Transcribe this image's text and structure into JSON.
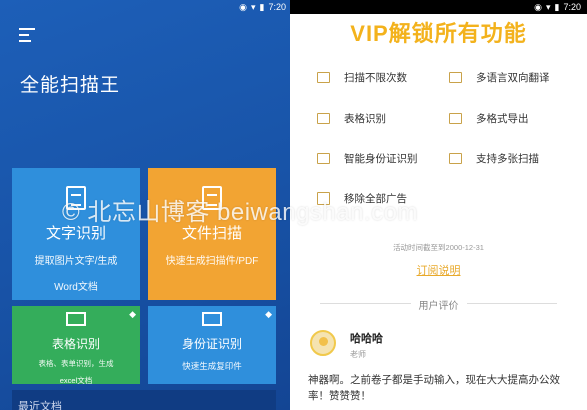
{
  "status": {
    "time": "7:20"
  },
  "left": {
    "app_title": "全能扫描王",
    "tiles": {
      "text_recognition": {
        "label": "文字识别",
        "desc_line1": "提取图片文字/生成",
        "desc_line2": "Word文档"
      },
      "file_scan": {
        "label": "文件扫描",
        "desc_line1": "快速生成扫描件/PDF"
      },
      "table_recognition": {
        "label": "表格识别",
        "desc_line1": "表格、表单识别，生成",
        "desc_line2": "excel文档"
      },
      "id_recognition": {
        "label": "身份证识别",
        "desc_line1": "快速生成复印件"
      }
    },
    "bottom_label": "最近文档"
  },
  "right": {
    "title": "VIP解锁所有功能",
    "features": [
      "扫描不限次数",
      "多语言双向翻译",
      "表格识别",
      "多格式导出",
      "智能身份证识别",
      "支持多张扫描",
      "移除全部广告"
    ],
    "promo_time": "活动时间截至到2000-12-31",
    "subscribe_label": "订阅说明",
    "reviews_heading": "用户评价",
    "review": {
      "name": "哈哈哈",
      "role": "老师",
      "text": "神器啊。之前卷子都是手动输入，现在大大提高办公效率！赞赞赞！"
    }
  },
  "watermark": "© 北忘山博客 beiwangshan.com"
}
